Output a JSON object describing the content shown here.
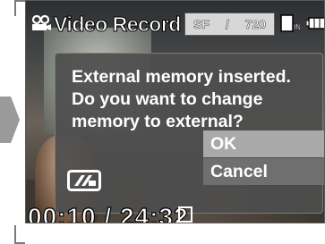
{
  "status_bar": {
    "mode_icon": "video-record-icon",
    "mode_title": "Video Record",
    "quality": {
      "mode": "SF",
      "separator": "/",
      "resolution": "720"
    },
    "memory_icon": "internal-memory-icon",
    "battery_icon": "battery-icon"
  },
  "dialog": {
    "message": "External memory inserted.\nDo you want to change\nmemory to external?",
    "options": [
      {
        "label": "OK",
        "selected": true
      },
      {
        "label": "Cancel",
        "selected": false
      }
    ],
    "memory_icon": "memory-card-icon"
  },
  "timecode": {
    "text": "00:10 / 24:32"
  },
  "colors": {
    "dialog_bg": "#4e4e4e",
    "selected_option_bg": "#a9a9a9",
    "option_bg": "#6f6f6f",
    "text": "#ffffff"
  }
}
